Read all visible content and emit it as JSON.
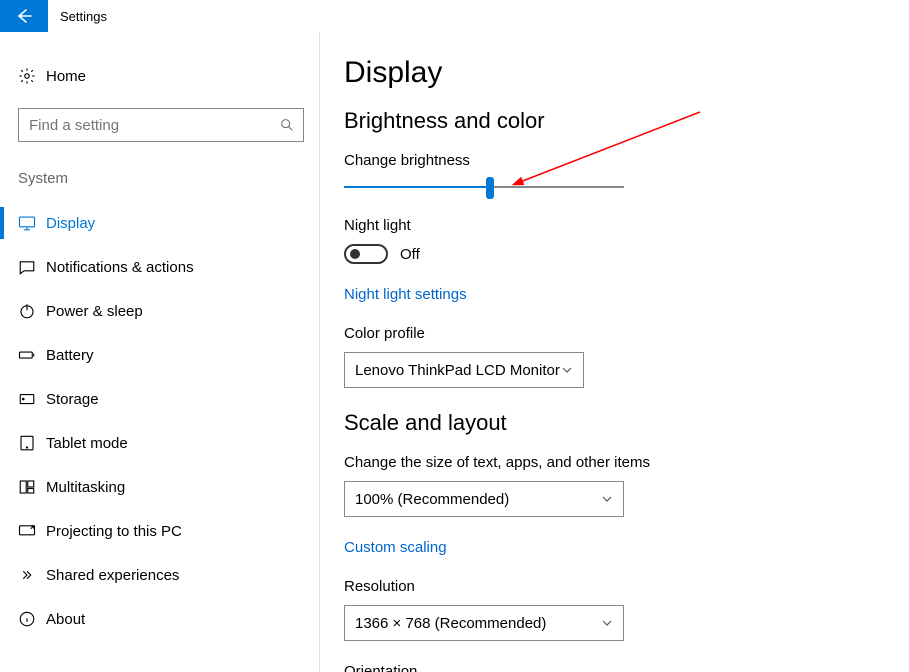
{
  "app": {
    "title": "Settings"
  },
  "sidebar": {
    "home_label": "Home",
    "search_placeholder": "Find a setting",
    "section_label": "System",
    "items": [
      {
        "label": "Display",
        "icon": "display-icon",
        "active": true
      },
      {
        "label": "Notifications & actions",
        "icon": "notifications-icon",
        "active": false
      },
      {
        "label": "Power & sleep",
        "icon": "power-icon",
        "active": false
      },
      {
        "label": "Battery",
        "icon": "battery-icon",
        "active": false
      },
      {
        "label": "Storage",
        "icon": "storage-icon",
        "active": false
      },
      {
        "label": "Tablet mode",
        "icon": "tablet-icon",
        "active": false
      },
      {
        "label": "Multitasking",
        "icon": "multitasking-icon",
        "active": false
      },
      {
        "label": "Projecting to this PC",
        "icon": "projecting-icon",
        "active": false
      },
      {
        "label": "Shared experiences",
        "icon": "shared-icon",
        "active": false
      },
      {
        "label": "About",
        "icon": "about-icon",
        "active": false
      }
    ]
  },
  "main": {
    "page_title": "Display",
    "brightness_color": {
      "section_title": "Brightness and color",
      "change_brightness_label": "Change brightness",
      "brightness_percent": 52,
      "night_light_label": "Night light",
      "night_light_state_label": "Off",
      "night_light_on": false,
      "night_light_settings_link": "Night light settings",
      "color_profile_label": "Color profile",
      "color_profile_value": "Lenovo ThinkPad LCD Monitor"
    },
    "scale_layout": {
      "section_title": "Scale and layout",
      "scale_label": "Change the size of text, apps, and other items",
      "scale_value": "100% (Recommended)",
      "custom_scaling_link": "Custom scaling",
      "resolution_label": "Resolution",
      "resolution_value": "1366 × 768 (Recommended)",
      "orientation_label": "Orientation"
    }
  }
}
